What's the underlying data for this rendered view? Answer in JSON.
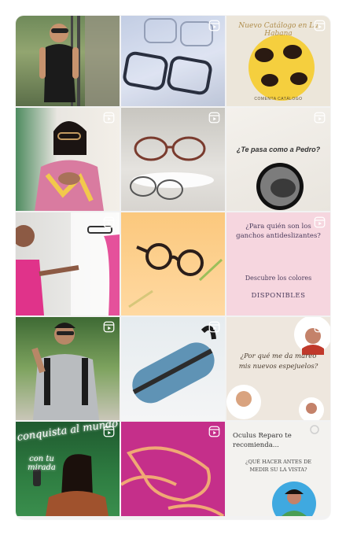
{
  "grid": {
    "tiles": [
      {
        "id": "t1",
        "reel": false
      },
      {
        "id": "t2",
        "reel": true
      },
      {
        "id": "t3",
        "reel": true,
        "title": "Nuevo Catálogo en La Habana",
        "subtitle": "COMENTA CATÁLOGO"
      },
      {
        "id": "t4",
        "reel": true
      },
      {
        "id": "t5",
        "reel": true
      },
      {
        "id": "t6",
        "reel": true,
        "text": "¿Te pasa como a Pedro?"
      },
      {
        "id": "t7",
        "reel": true
      },
      {
        "id": "t8",
        "reel": false
      },
      {
        "id": "t9",
        "reel": true,
        "line1": "¿Para quién son los ganchos antideslizantes?",
        "line2": "Descubre los colores",
        "line3": "DISPONIBLES"
      },
      {
        "id": "t10",
        "reel": true
      },
      {
        "id": "t11",
        "reel": true
      },
      {
        "id": "t12",
        "reel": true,
        "text": "¿Por qué me da mareo mis nuevos espejuelos?"
      },
      {
        "id": "t13",
        "reel": true,
        "neon": "conquista al mundo",
        "neon2": "con tu mirada"
      },
      {
        "id": "t14",
        "reel": true
      },
      {
        "id": "t15",
        "reel": false,
        "line1": "Oculus Reparo te recomienda...",
        "line2": "¿QUÉ HACER ANTES DE MEDIR SU LA VISTA?"
      }
    ]
  },
  "colors": {
    "reel_icon": "#ffffff"
  },
  "icons": {
    "reel": "reels-icon"
  }
}
